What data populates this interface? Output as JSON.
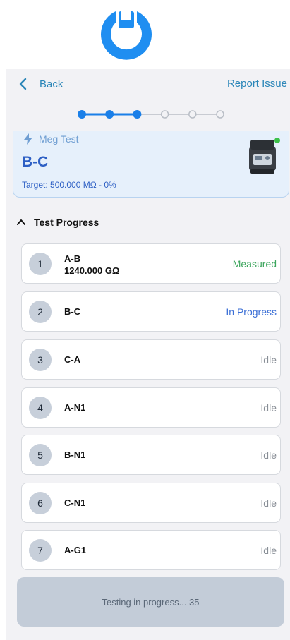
{
  "header": {
    "back_label": "Back",
    "report_label": "Report Issue"
  },
  "stepper": {
    "total_steps": 6,
    "completed_steps": 3
  },
  "test_card": {
    "type_label": "Meg Test",
    "name": "B-C",
    "target": "Target: 500.000 MΩ - 0%",
    "device_status_color": "#3cc14a"
  },
  "progress_section": {
    "title": "Test Progress"
  },
  "rows": [
    {
      "num": "1",
      "name": "A-B",
      "value": "1240.000 GΩ",
      "status": "Measured",
      "status_color": "#3ba55c"
    },
    {
      "num": "2",
      "name": "B-C",
      "value": "",
      "status": "In Progress",
      "status_color": "#3b6fd6"
    },
    {
      "num": "3",
      "name": "C-A",
      "value": "",
      "status": "Idle",
      "status_color": "#888e96"
    },
    {
      "num": "4",
      "name": "A-N1",
      "value": "",
      "status": "Idle",
      "status_color": "#888e96"
    },
    {
      "num": "5",
      "name": "B-N1",
      "value": "",
      "status": "Idle",
      "status_color": "#888e96"
    },
    {
      "num": "6",
      "name": "C-N1",
      "value": "",
      "status": "Idle",
      "status_color": "#888e96"
    },
    {
      "num": "7",
      "name": "A-G1",
      "value": "",
      "status": "Idle",
      "status_color": "#888e96"
    }
  ],
  "footer": {
    "label": "Testing in progress... 35"
  },
  "colors": {
    "accent": "#1a7fe8",
    "link": "#2b86b8",
    "logo": "#1f8ef1"
  }
}
